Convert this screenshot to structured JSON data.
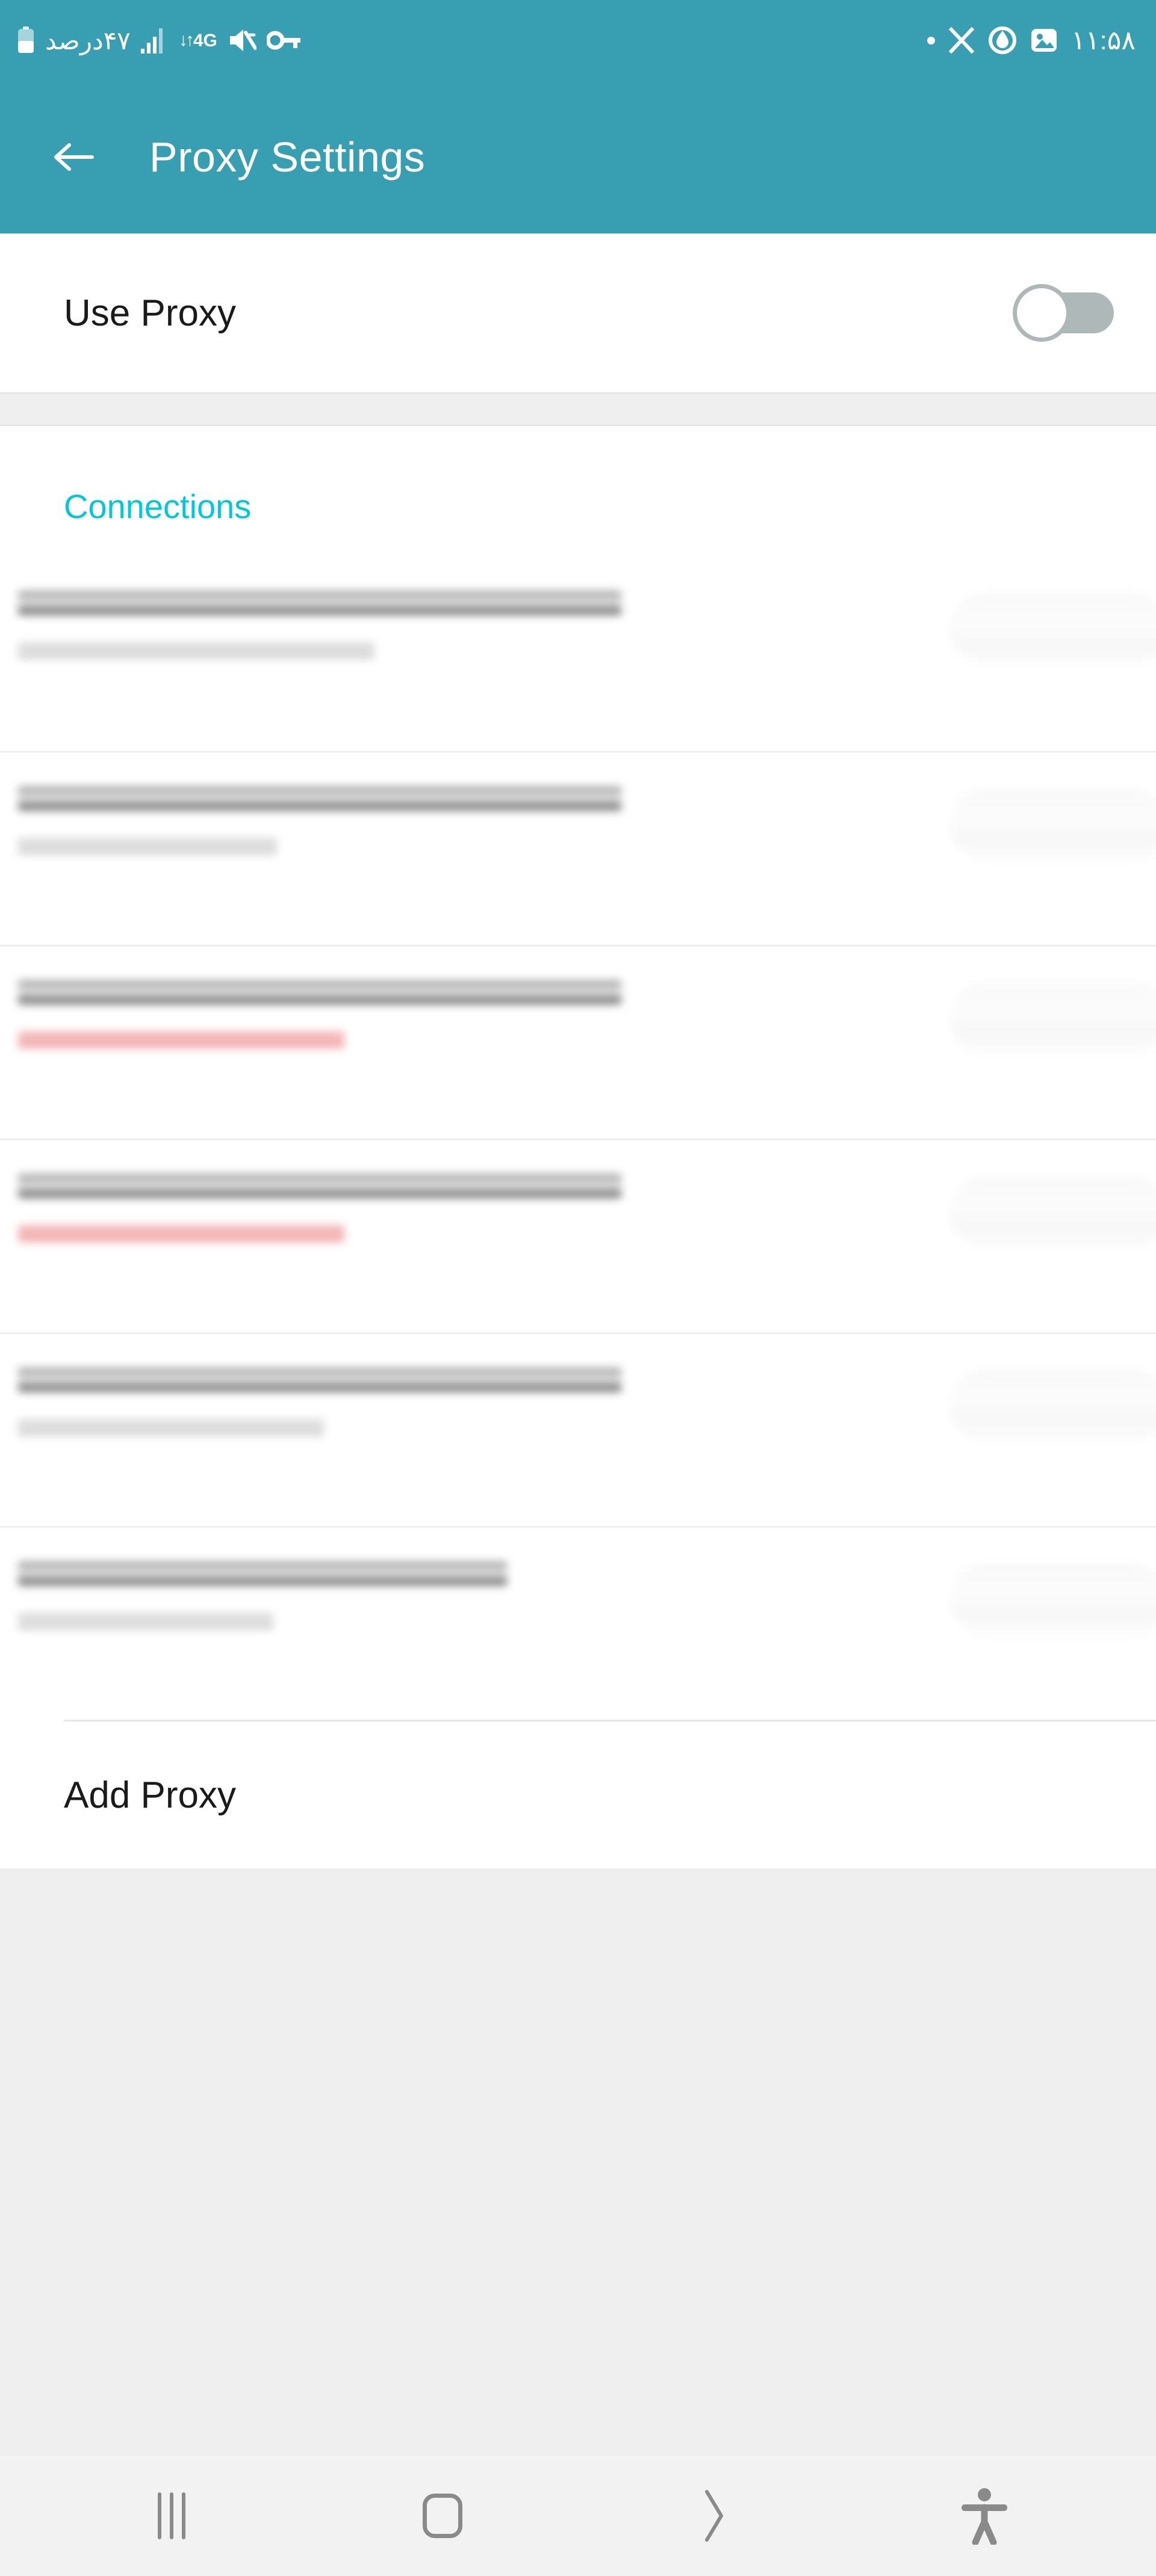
{
  "theme": {
    "header_bg": "#389FB3",
    "accent_cyan": "#00C8DC",
    "page_bg": "#EFEFEF",
    "card_bg": "#FFFFFF",
    "error_red": "#E24646",
    "toggle_off_gray": "#AFB8B9",
    "nav_icon_gray": "#8A8A8A"
  },
  "status_bar": {
    "battery_percent_text": "۴۷درصد",
    "network_label": "4G",
    "data_arrows": "↓↑",
    "icons_left": [
      "battery-icon",
      "signal-bars-icon",
      "network-4g-icon",
      "data-transfer-icon",
      "mute-icon",
      "vpn-key-icon"
    ],
    "icons_right": [
      "dot-indicator-icon",
      "x-app-icon",
      "power-drop-icon",
      "gallery-icon"
    ],
    "clock": "۱۱:۵۸"
  },
  "app_bar": {
    "back_label": "←",
    "title": "Proxy Settings"
  },
  "use_proxy": {
    "label": "Use Proxy",
    "enabled": false,
    "state_text": "off"
  },
  "connections": {
    "section_title": "Connections",
    "items": [
      {
        "title_redacted": true,
        "subtitle_redacted": true,
        "subtitle_state": "normal",
        "chip_redacted": true,
        "title_width": 1002,
        "subtitle_width": 592
      },
      {
        "title_redacted": true,
        "subtitle_redacted": true,
        "subtitle_state": "normal",
        "chip_redacted": true,
        "title_width": 1002,
        "subtitle_width": 430
      },
      {
        "title_redacted": true,
        "subtitle_redacted": true,
        "subtitle_state": "error",
        "chip_redacted": true,
        "title_width": 1002,
        "subtitle_width": 542
      },
      {
        "title_redacted": true,
        "subtitle_redacted": true,
        "subtitle_state": "error",
        "chip_redacted": true,
        "title_width": 1002,
        "subtitle_width": 542
      },
      {
        "title_redacted": true,
        "subtitle_redacted": true,
        "subtitle_state": "normal",
        "chip_redacted": true,
        "title_width": 1002,
        "subtitle_width": 508
      },
      {
        "title_redacted": true,
        "subtitle_redacted": true,
        "subtitle_state": "normal",
        "chip_redacted": true,
        "title_width": 812,
        "subtitle_width": 424
      }
    ]
  },
  "add_proxy": {
    "label": "Add Proxy"
  },
  "nav_bar": {
    "buttons": [
      {
        "name": "recents",
        "icon": "recents-icon"
      },
      {
        "name": "home",
        "icon": "home-icon"
      },
      {
        "name": "back",
        "icon": "back-chevron-icon"
      },
      {
        "name": "accessibility",
        "icon": "accessibility-icon"
      }
    ]
  }
}
